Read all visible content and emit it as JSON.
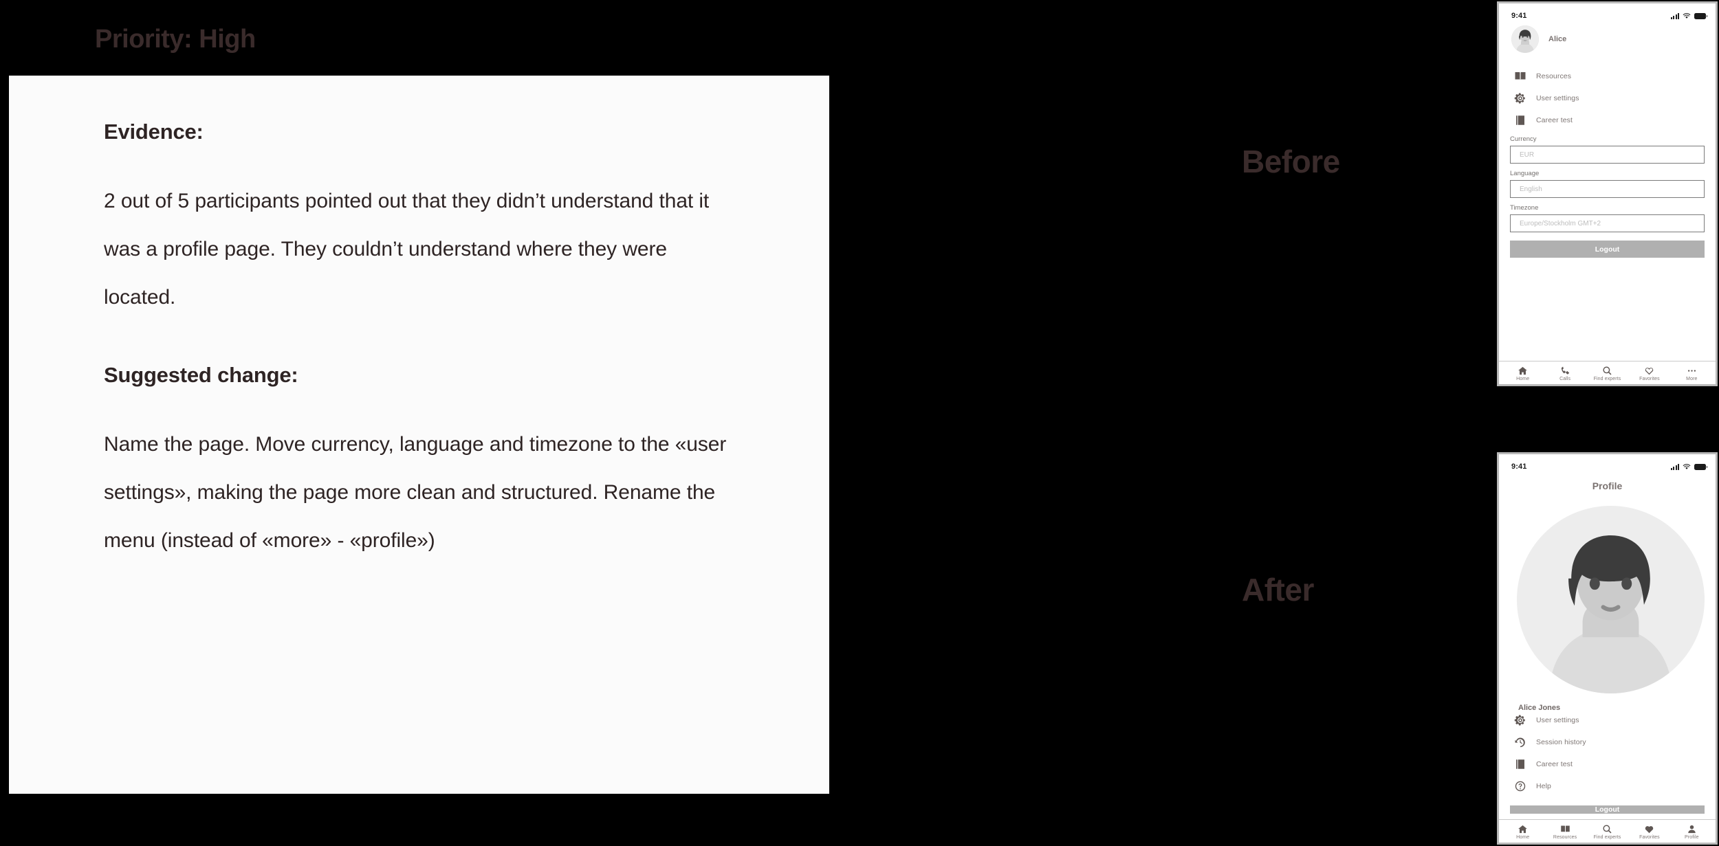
{
  "slide": {
    "title": "Priority: High",
    "before_label": "Before",
    "after_label": "After"
  },
  "note": {
    "evidence_heading": "Evidence:",
    "evidence_body": "2 out of 5 participants pointed out that they didn’t understand that it was a profile page. They couldn’t understand where they were located.",
    "suggestion_heading": "Suggested change:",
    "suggestion_body": "Name the page. Move currency, language and timezone to the «user settings», making the page more clean and structured. Rename the menu (instead of «more» - «profile»)"
  },
  "before_phone": {
    "status": {
      "time": "9:41",
      "signal_icon": "signal-bars-icon",
      "wifi_icon": "wifi-icon",
      "battery_icon": "battery-icon"
    },
    "user": {
      "name": "Alice",
      "avatar_icon": "user-avatar-photo"
    },
    "menu": [
      {
        "label": "Resources",
        "icon": "book-icon"
      },
      {
        "label": "User settings",
        "icon": "gear-icon"
      },
      {
        "label": "Career test",
        "icon": "document-list-icon"
      }
    ],
    "fields": [
      {
        "label": "Currency",
        "value": "EUR"
      },
      {
        "label": "Language",
        "value": "English"
      },
      {
        "label": "Timezone",
        "value": "Europe/Stockholm GMT+2"
      }
    ],
    "logout_label": "Logout",
    "tabs": [
      {
        "label": "Home",
        "icon": "home-icon"
      },
      {
        "label": "Calls",
        "icon": "phone-icon"
      },
      {
        "label": "Find experts",
        "icon": "search-icon"
      },
      {
        "label": "Favorites",
        "icon": "heart-outline-icon"
      },
      {
        "label": "More",
        "icon": "ellipsis-icon"
      }
    ]
  },
  "after_phone": {
    "status": {
      "time": "9:41",
      "signal_icon": "signal-bars-icon",
      "wifi_icon": "wifi-icon",
      "battery_icon": "battery-icon"
    },
    "page_title": "Profile",
    "user": {
      "name": "Alice Jones",
      "avatar_icon": "user-avatar-photo"
    },
    "menu": [
      {
        "label": "User settings",
        "icon": "gear-icon"
      },
      {
        "label": "Session history",
        "icon": "history-clock-icon"
      },
      {
        "label": "Career test",
        "icon": "document-list-icon"
      },
      {
        "label": "Help",
        "icon": "question-circle-icon"
      }
    ],
    "logout_label": "Logout",
    "tabs": [
      {
        "label": "Home",
        "icon": "home-icon"
      },
      {
        "label": "Resources",
        "icon": "book-icon"
      },
      {
        "label": "Find experts",
        "icon": "search-icon"
      },
      {
        "label": "Favorites",
        "icon": "heart-filled-icon"
      },
      {
        "label": "Profile",
        "icon": "person-icon"
      }
    ]
  },
  "colors": {
    "background": "#000000",
    "card": "#fbfbfb",
    "title_text": "#3a2b2b",
    "body_text": "#2e2424",
    "ui_gray": "#7e7674",
    "logout_bg": "#b0b0b0",
    "placeholder": "#bdbdbd"
  }
}
